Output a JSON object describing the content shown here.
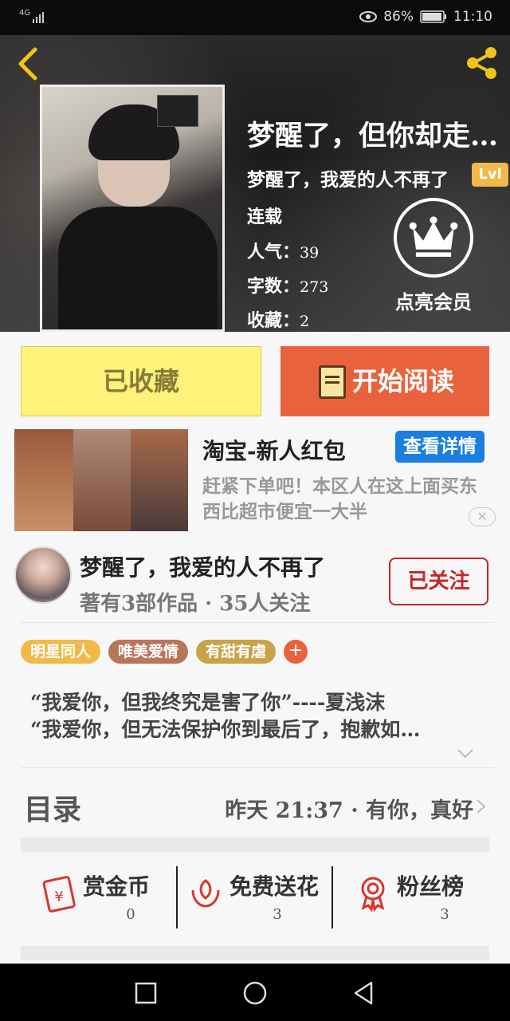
{
  "status": {
    "network": "4G",
    "battery_pct": "86%",
    "time": "11:10"
  },
  "book": {
    "title": "梦醒了，但你却走…",
    "author_line": "梦醒了，我爱的人不再了",
    "level": "Lvl",
    "status": "连载",
    "popularity_label": "人气：",
    "popularity": "39",
    "words_label": "字数：",
    "words": "273",
    "favorites_label": "收藏：",
    "favorites": "2",
    "vip_label": "点亮会员"
  },
  "actions": {
    "favorited_label": "已收藏",
    "read_label": "开始阅读"
  },
  "ad": {
    "title": "淘宝-新人红包",
    "cta": "查看详情",
    "desc": "赶紧下单吧！本区人在这上面买东西比超市便宜一大半",
    "close": "✕"
  },
  "author": {
    "name": "梦醒了，我爱的人不再了",
    "stats": "著有3部作品 · 35人关注",
    "follow_label": "已关注"
  },
  "tags": [
    {
      "label": "明星同人",
      "color": "#f0b94a"
    },
    {
      "label": "唯美爱情",
      "color": "#b8755a"
    },
    {
      "label": "有甜有虐",
      "color": "#c9a24a"
    }
  ],
  "tag_add": "+",
  "intro": [
    "“我爱你，但我终究是害了你”----夏浅沫",
    "“我爱你，但无法保护你到最后了，抱歉如…"
  ],
  "toc": {
    "label": "目录",
    "latest": "昨天 21:37 · 有你，真好"
  },
  "stats": [
    {
      "label": "赏金币",
      "value": "0",
      "icon": "red-envelope-yen-icon"
    },
    {
      "label": "免费送花",
      "value": "3",
      "icon": "flower-icon"
    },
    {
      "label": "粉丝榜",
      "value": "3",
      "icon": "medal-icon"
    }
  ],
  "colors": {
    "accent": "#e8623e",
    "fav": "#fdf27a",
    "follow": "#c9242a",
    "ad_cta": "#1a7fe0"
  }
}
